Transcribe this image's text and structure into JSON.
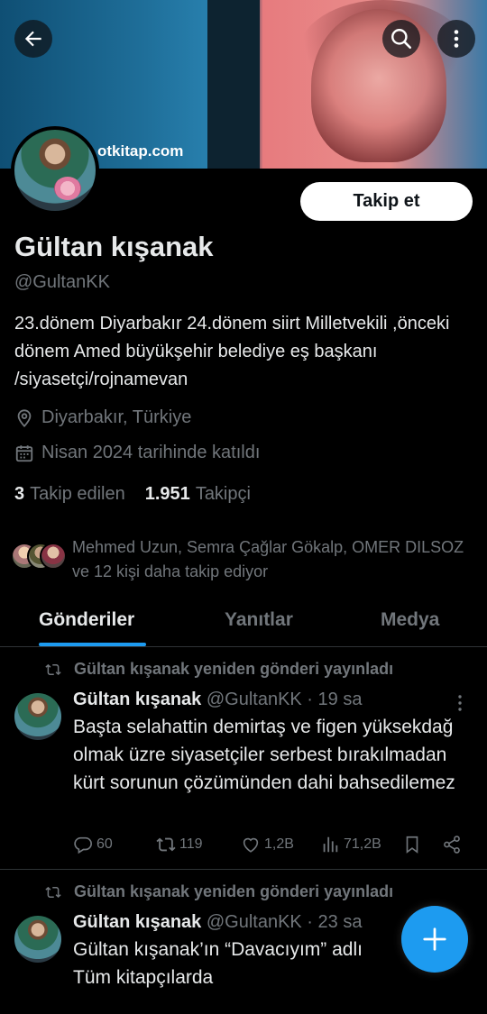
{
  "banner": {
    "site_text": "otkitap.com"
  },
  "header": {
    "back_icon": "arrow-left-icon",
    "search_icon": "search-icon",
    "more_icon": "more-vertical-icon"
  },
  "profile": {
    "follow_label": "Takip et",
    "name": "Gültan kışanak",
    "handle": "@GultanKK",
    "bio": "23.dönem Diyarbakır 24.dönem siirt Milletvekili ,önceki dönem Amed büyükşehir belediye eş başkanı /siyasetçi/rojnamevan",
    "location": "Diyarbakır, Türkiye",
    "joined": "Nisan 2024 tarihinde katıldı",
    "following_count": "3",
    "following_label": "Takip edilen",
    "followers_count": "1.951",
    "followers_label": "Takipçi",
    "known_followers": "Mehmed Uzun, Semra Çağlar Gökalp, OMER DILSOZ ve 12 kişi daha takip ediyor"
  },
  "tabs": [
    {
      "label": "Gönderiler",
      "active": true
    },
    {
      "label": "Yanıtlar",
      "active": false
    },
    {
      "label": "Medya",
      "active": false
    }
  ],
  "posts": [
    {
      "repost_label": "Gültan kışanak yeniden gönderi yayınladı",
      "author": "Gültan kışanak",
      "handle_time": "@GultanKK · 19 sa",
      "text": "Başta selahattin demirtaş ve figen yüksekdağ olmak üzre siyasetçiler serbest bırakılmadan kürt sorunun çözümünden dahi bahsedilemez",
      "replies": "60",
      "reposts": "119",
      "likes": "1,2B",
      "views": "71,2B"
    },
    {
      "repost_label": "Gültan kışanak yeniden gönderi yayınladı",
      "author": "Gültan kışanak",
      "handle_time": "@GultanKK · 23 sa",
      "text_line1": "Gültan kışanak’ın “Davacıyım” adlı",
      "text_line2": "Tüm kitapçılarda"
    }
  ],
  "fab": {
    "icon": "plus-icon"
  },
  "colors": {
    "accent": "#1d9bf0",
    "muted": "#71767b",
    "text": "#e7e9ea",
    "background": "#000000"
  }
}
